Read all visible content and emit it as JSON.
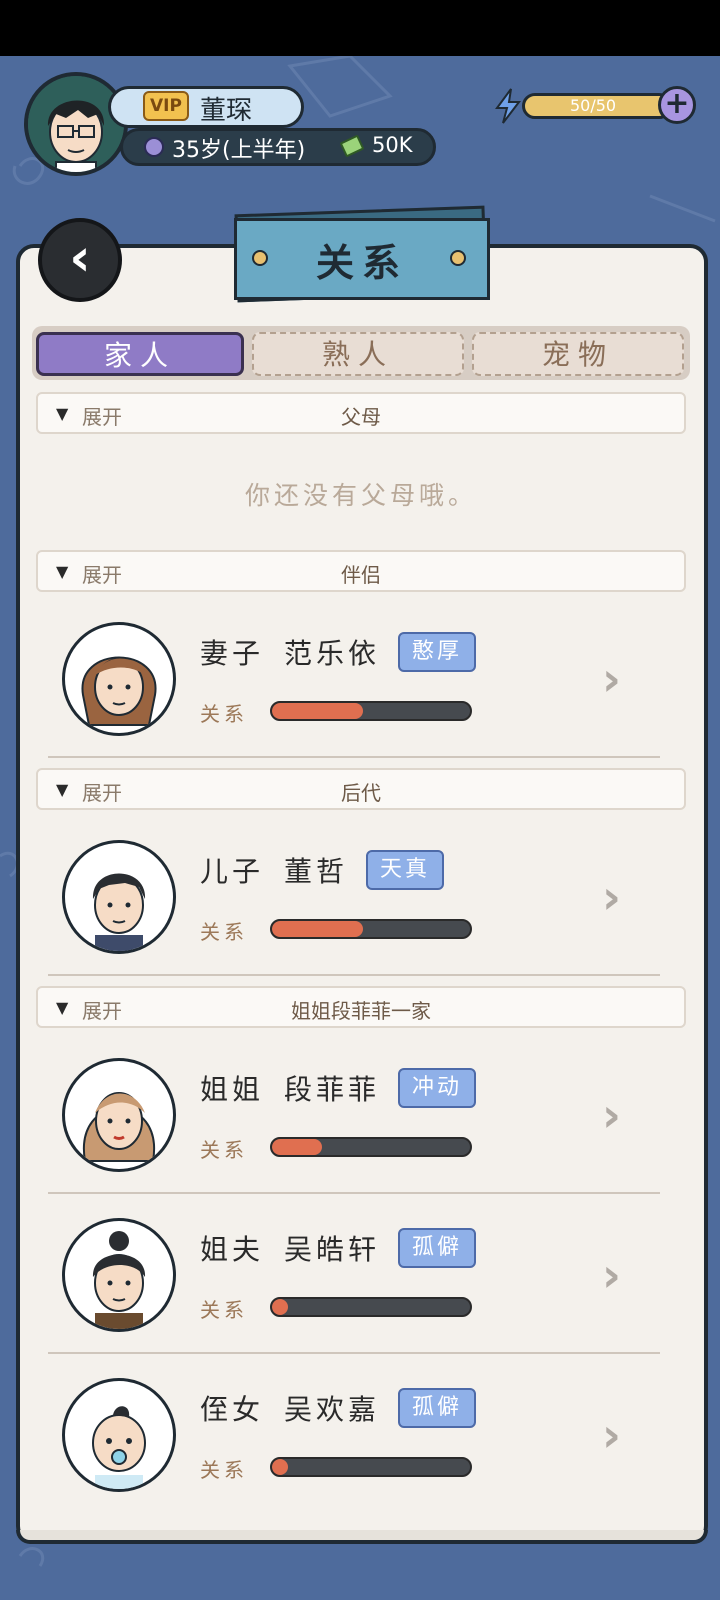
{
  "header": {
    "vip_label": "VIP",
    "player_name": "董琛",
    "age": "35岁(上半年)",
    "money": "50K",
    "energy": "50/50",
    "energy_plus": "+"
  },
  "panel": {
    "title": "关系",
    "back_icon": "chevron-left-icon"
  },
  "tabs": [
    {
      "label": "家人",
      "active": true
    },
    {
      "label": "熟人",
      "active": false
    },
    {
      "label": "宠物",
      "active": false
    }
  ],
  "sections": {
    "parents": {
      "expand": "展开",
      "title": "父母",
      "empty_text": "你还没有父母哦。"
    },
    "partner": {
      "expand": "展开",
      "title": "伴侣"
    },
    "children": {
      "expand": "展开",
      "title": "后代"
    },
    "sister_family": {
      "expand": "展开",
      "title": "姐姐段菲菲一家"
    }
  },
  "members": [
    {
      "role": "妻子",
      "name": "范乐依",
      "trait": "憨厚",
      "relation_label": "关系",
      "relation_level": 0.46
    },
    {
      "role": "儿子",
      "name": "董哲",
      "trait": "天真",
      "relation_label": "关系",
      "relation_level": 0.46
    },
    {
      "role": "姐姐",
      "name": "段菲菲",
      "trait": "冲动",
      "relation_label": "关系",
      "relation_level": 0.25
    },
    {
      "role": "姐夫",
      "name": "吴皓轩",
      "trait": "孤僻",
      "relation_label": "关系",
      "relation_level": 0.08
    },
    {
      "role": "侄女",
      "name": "吴欢嘉",
      "trait": "孤僻",
      "relation_label": "关系",
      "relation_level": 0.06
    }
  ],
  "colors": {
    "background": "#4e6b9c",
    "panel": "#f4f1ec",
    "tab_active": "#8f7bc6",
    "trait_badge": "#8fb0e8",
    "relation_fill": "#e06f50"
  }
}
